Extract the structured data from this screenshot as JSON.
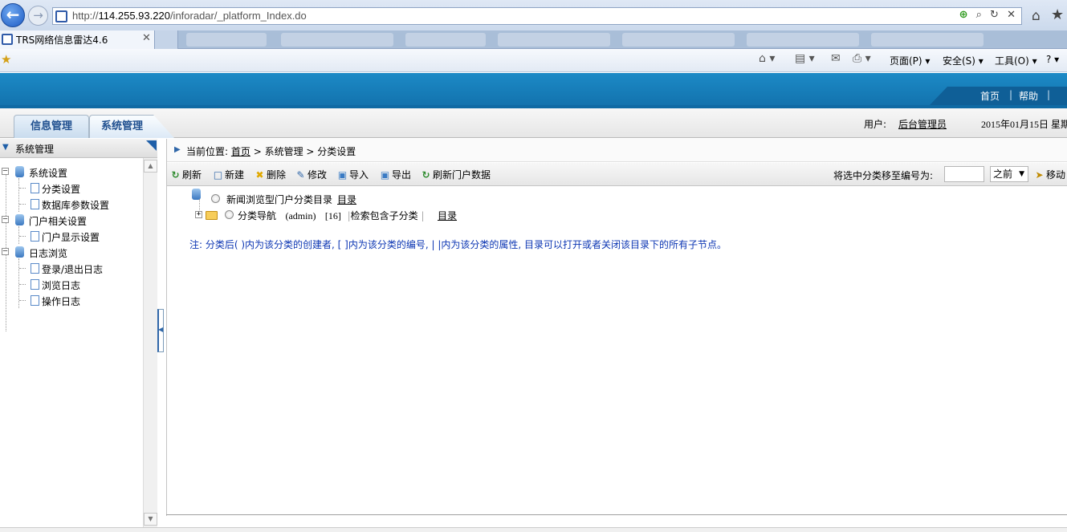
{
  "browser": {
    "url_prefix": "http://",
    "url_host": "114.255.93.220",
    "url_path": "/inforadar/_platform_Index.do",
    "tab_title": "TRS网络信息雷达4.6",
    "tab_close": "✕",
    "url_tools": "⊕ ⌕ ▾ ↻ ✕",
    "commands": {
      "page": "页面(P) ▾",
      "safety": "安全(S) ▾",
      "tools": "工具(O) ▾",
      "help": "? ▾"
    }
  },
  "header": {
    "links": {
      "home": "首页",
      "sep": "|",
      "help": "帮助",
      "sep2": "|"
    },
    "user_label": "用户:",
    "user_name": "后台管理员",
    "date": "2015年01月15日 星期"
  },
  "tabs": {
    "info": "信息管理",
    "system": "系统管理"
  },
  "sidebar": {
    "title": "系统管理",
    "tree": [
      {
        "label": "系统设置",
        "level": 0
      },
      {
        "label": "分类设置",
        "level": 1
      },
      {
        "label": "数据库参数设置",
        "level": 1
      },
      {
        "label": "门户相关设置",
        "level": 0
      },
      {
        "label": "门户显示设置",
        "level": 1
      },
      {
        "label": "日志浏览",
        "level": 0
      },
      {
        "label": "登录/退出日志",
        "level": 1
      },
      {
        "label": "浏览日志",
        "level": 1
      },
      {
        "label": "操作日志",
        "level": 1
      }
    ]
  },
  "breadcrumb": {
    "prefix": "当前位置:",
    "home": "首页",
    "rest": " > 系统管理 > 分类设置"
  },
  "toolbar": {
    "refresh": "刷新",
    "new": "新建",
    "delete": "删除",
    "edit": "修改",
    "import": "导入",
    "export": "导出",
    "refresh_portal": "刷新门户数据",
    "move_label": "将选中分类移至编号为:",
    "move_input_value": "",
    "position_option": "之前",
    "move_button": "移动"
  },
  "catalog": {
    "root_label": "新闻浏览型门户分类目录",
    "root_link": "目录",
    "node_label": "分类导航",
    "node_creator": "(admin)",
    "node_id": "[16]",
    "node_attr_sep": "|",
    "node_attr": "检索包含子分类",
    "node_attr_end": "|",
    "node_link": "目录"
  },
  "note": "注: 分类后( )内为该分类的创建者, [ ]内为该分类的编号, | |内为该分类的属性, 目录可以打开或者关闭该目录下的所有子节点。",
  "colors": {
    "banner": "#1c8ac6",
    "tab_text": "#1f4f8f",
    "note_text": "#0c36b3"
  }
}
